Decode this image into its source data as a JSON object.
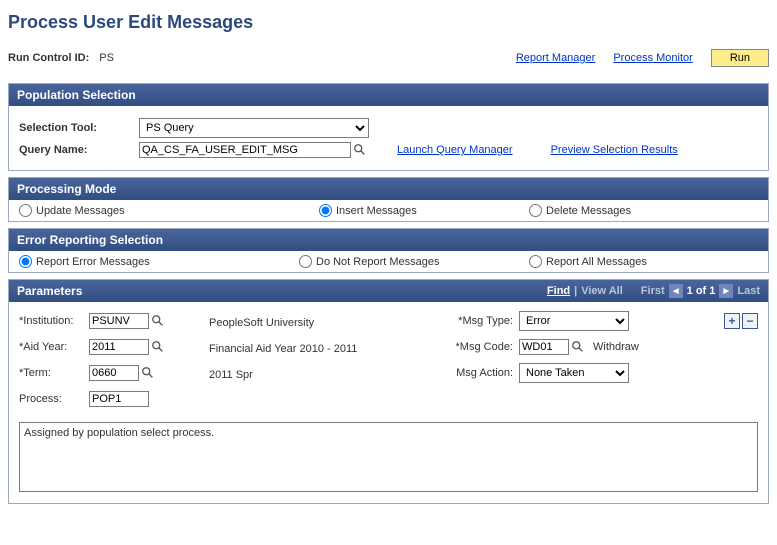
{
  "page_title": "Process User Edit Messages",
  "runctl": {
    "label": "Run Control ID:",
    "value": "PS",
    "report_manager": "Report Manager",
    "process_monitor": "Process Monitor",
    "run_btn": "Run"
  },
  "pop_selection": {
    "header": "Population Selection",
    "selection_tool_label": "Selection Tool:",
    "selection_tool_value": "PS Query",
    "query_name_label": "Query Name:",
    "query_name_value": "QA_CS_FA_USER_EDIT_MSG",
    "launch_query_manager": "Launch Query Manager",
    "preview_results": "Preview Selection Results"
  },
  "processing_mode": {
    "header": "Processing Mode",
    "options": {
      "update": "Update Messages",
      "insert": "Insert Messages",
      "delete": "Delete Messages"
    },
    "selected": "insert"
  },
  "error_reporting": {
    "header": "Error Reporting Selection",
    "options": {
      "report_errors": "Report Error Messages",
      "do_not_report": "Do Not Report Messages",
      "report_all": "Report All Messages"
    },
    "selected": "report_errors"
  },
  "parameters": {
    "header": "Parameters",
    "nav": {
      "find": "Find",
      "view_all": "View All",
      "first": "First",
      "counter": "1 of 1",
      "last": "Last"
    },
    "fields": {
      "institution_label": "*Institution:",
      "institution_value": "PSUNV",
      "institution_desc": "PeopleSoft University",
      "aid_year_label": "*Aid Year:",
      "aid_year_value": "2011",
      "aid_year_desc": "Financial Aid Year 2010 - 2011",
      "term_label": "*Term:",
      "term_value": "0660",
      "term_desc": "2011 Spr",
      "process_label": "Process:",
      "process_value": "POP1",
      "msg_type_label": "*Msg Type:",
      "msg_type_value": "Error",
      "msg_code_label": "*Msg Code:",
      "msg_code_value": "WD01",
      "msg_code_desc": "Withdraw",
      "msg_action_label": "Msg Action:",
      "msg_action_value": "None Taken"
    },
    "message_text": "Assigned by population select process."
  }
}
